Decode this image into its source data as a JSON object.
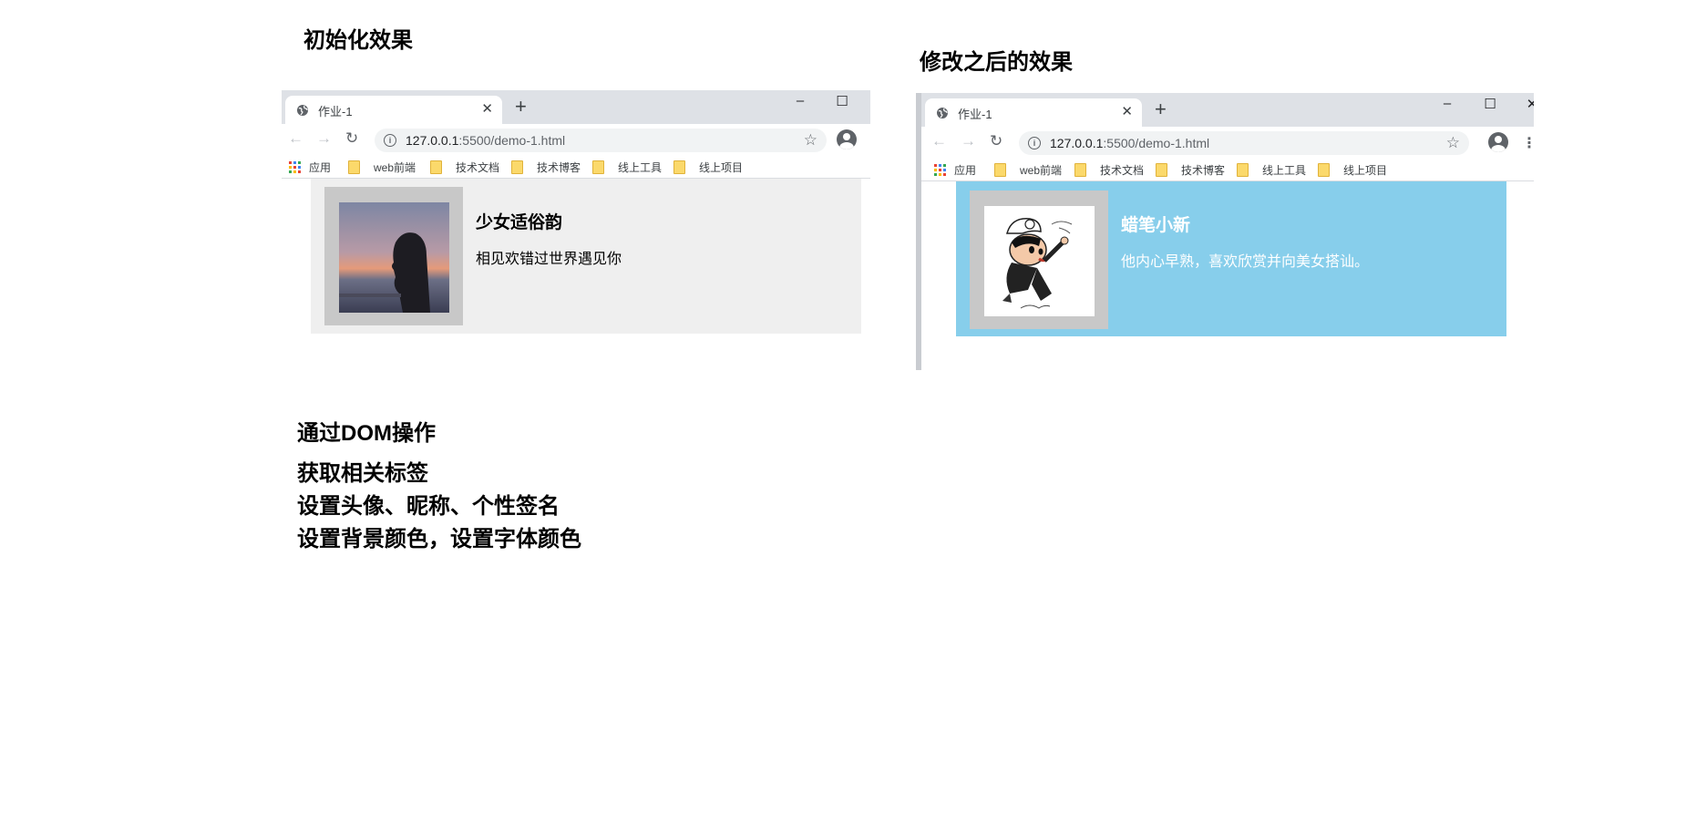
{
  "headings": {
    "initial": "初始化效果",
    "modified": "修改之后的效果"
  },
  "notes": {
    "title": "通过DOM操作",
    "steps": [
      "获取相关标签",
      "设置头像、昵称、个性签名",
      "设置背景颜色，设置字体颜色"
    ]
  },
  "browser": {
    "tab_title": "作业-1",
    "tab_close": "✕",
    "new_tab": "+",
    "window_controls": {
      "minimize": "–",
      "maximize": "☐",
      "close": "✕"
    },
    "url_host": "127.0.0.1",
    "url_rest": ":5500/demo-1.html",
    "bookmarks": [
      "应用",
      "web前端",
      "技术文档",
      "技术博客",
      "线上工具",
      "线上项目"
    ],
    "icons": [
      "globe-icon",
      "back-arrow-icon",
      "forward-arrow-icon",
      "reload-icon",
      "info-icon",
      "star-icon",
      "profile-icon",
      "apps-icon",
      "folder-icon",
      "kebab-menu-icon"
    ]
  },
  "card_initial": {
    "nickname": "少女适俗韵",
    "signature": "相见欢错过世界遇见你",
    "background": "#efefef",
    "text_color": "#000000"
  },
  "card_modified": {
    "nickname": "蜡笔小新",
    "signature": "他内心早熟，喜欢欣赏并向美女搭讪。",
    "background": "#87ceeb",
    "text_color": "#ffffff"
  }
}
